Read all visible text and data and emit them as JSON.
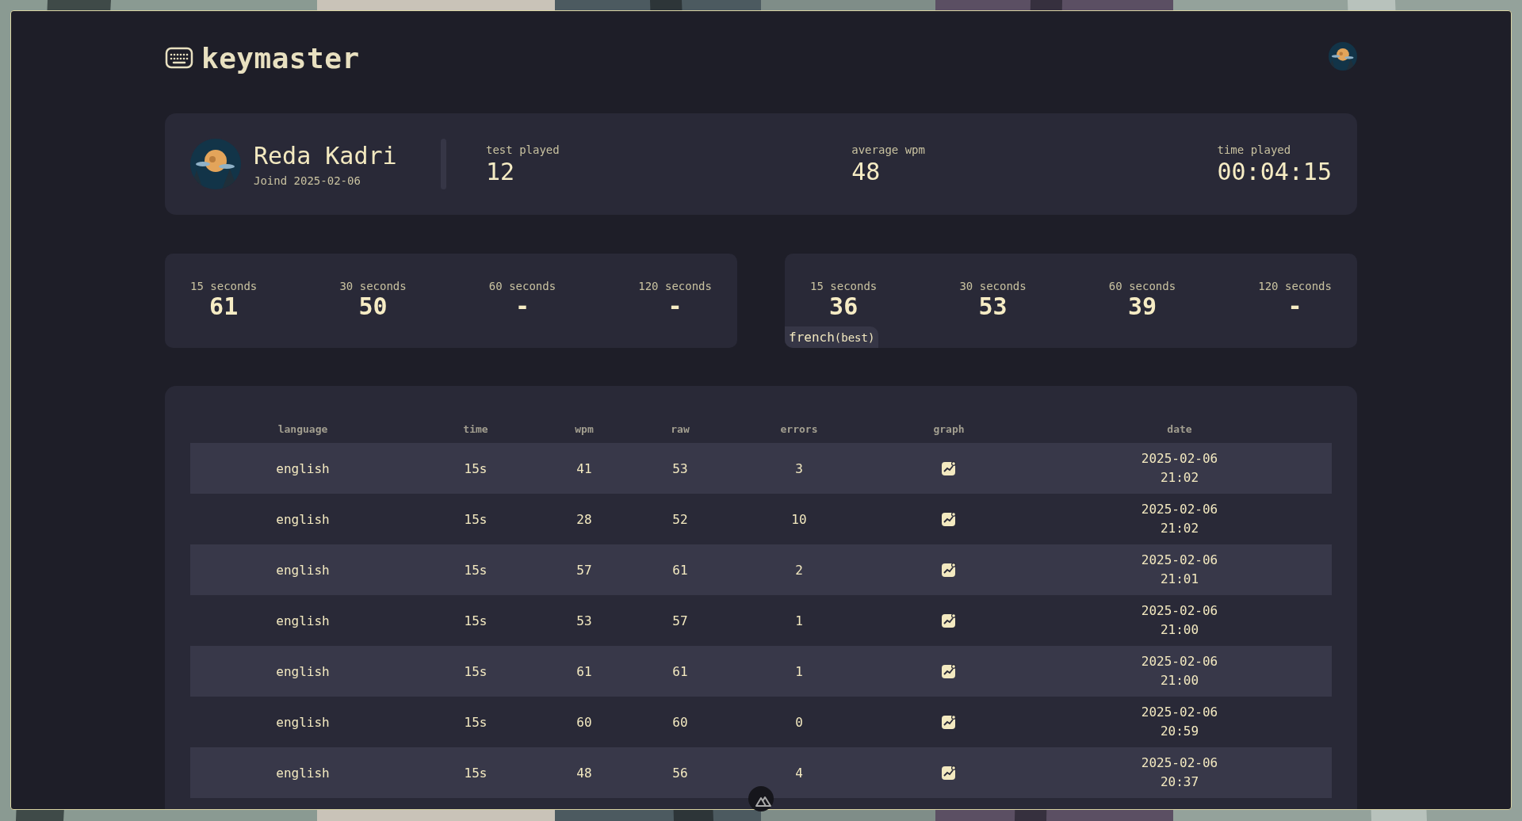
{
  "app": {
    "title": "keymaster"
  },
  "profile": {
    "name": "Reda Kadri",
    "joined": "Joind 2025-02-06",
    "stats": [
      {
        "label": "test played",
        "value": "12"
      },
      {
        "label": "average wpm",
        "value": "48"
      },
      {
        "label": "time played",
        "value": "00:04:15"
      }
    ]
  },
  "best_cards": [
    {
      "items": [
        {
          "label": "15 seconds",
          "value": "61"
        },
        {
          "label": "30 seconds",
          "value": "50"
        },
        {
          "label": "60 seconds",
          "value": "-"
        },
        {
          "label": "120 seconds",
          "value": "-"
        }
      ]
    },
    {
      "items": [
        {
          "label": "15 seconds",
          "value": "36"
        },
        {
          "label": "30 seconds",
          "value": "53"
        },
        {
          "label": "60 seconds",
          "value": "39"
        },
        {
          "label": "120 seconds",
          "value": "-"
        }
      ],
      "badge": {
        "language": "french",
        "note": "(best)"
      }
    }
  ],
  "table": {
    "columns": [
      "language",
      "time",
      "wpm",
      "raw",
      "errors",
      "graph",
      "date"
    ],
    "rows": [
      {
        "language": "english",
        "time": "15s",
        "wpm": "41",
        "raw": "53",
        "errors": "3",
        "date": "2025-02-06\n21:02"
      },
      {
        "language": "english",
        "time": "15s",
        "wpm": "28",
        "raw": "52",
        "errors": "10",
        "date": "2025-02-06\n21:02"
      },
      {
        "language": "english",
        "time": "15s",
        "wpm": "57",
        "raw": "61",
        "errors": "2",
        "date": "2025-02-06\n21:01"
      },
      {
        "language": "english",
        "time": "15s",
        "wpm": "53",
        "raw": "57",
        "errors": "1",
        "date": "2025-02-06\n21:00"
      },
      {
        "language": "english",
        "time": "15s",
        "wpm": "61",
        "raw": "61",
        "errors": "1",
        "date": "2025-02-06\n21:00"
      },
      {
        "language": "english",
        "time": "15s",
        "wpm": "60",
        "raw": "60",
        "errors": "0",
        "date": "2025-02-06\n20:59"
      },
      {
        "language": "english",
        "time": "15s",
        "wpm": "48",
        "raw": "56",
        "errors": "4",
        "date": "2025-02-06\n20:37"
      }
    ]
  }
}
